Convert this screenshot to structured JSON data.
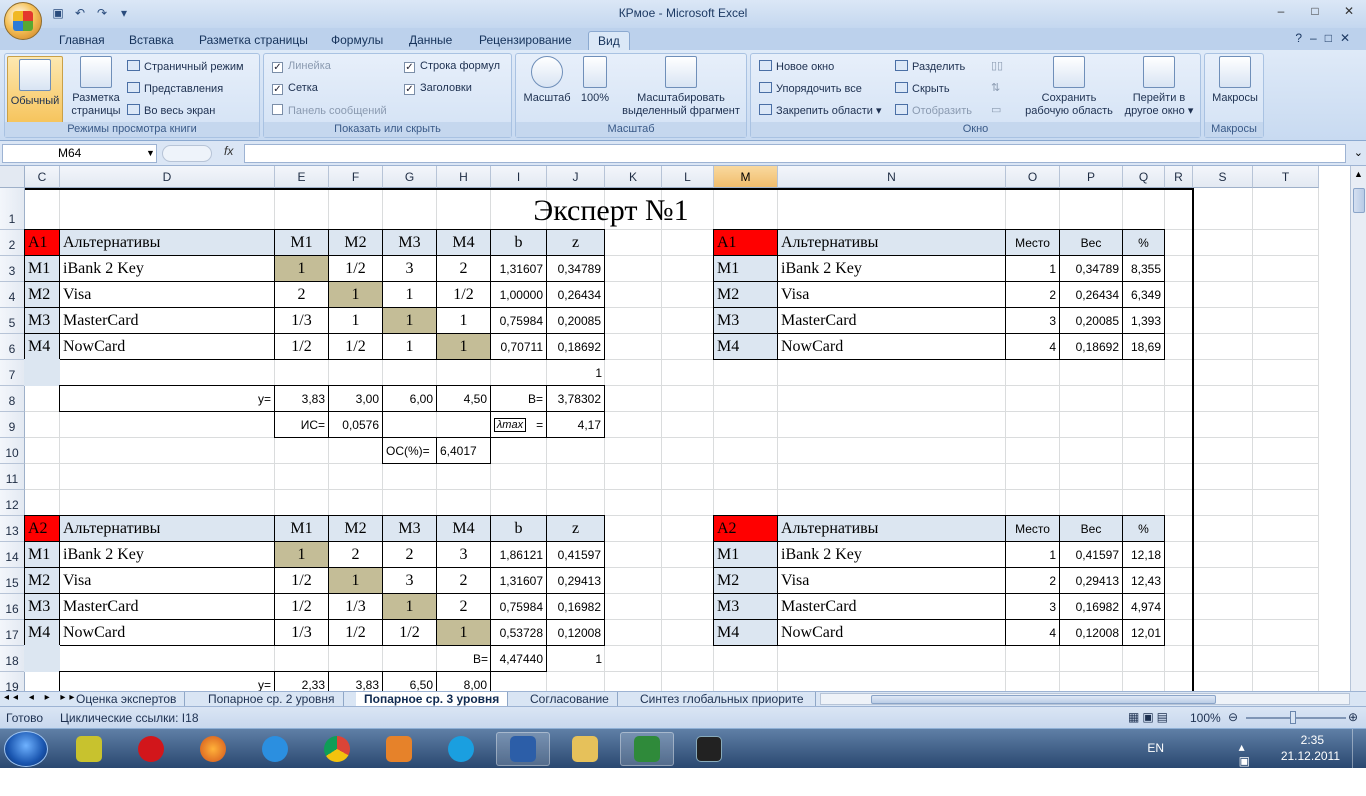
{
  "window": {
    "title": "КРмое - Microsoft Excel"
  },
  "ribbon_tabs": [
    "Главная",
    "Вставка",
    "Разметка страницы",
    "Формулы",
    "Данные",
    "Рецензирование",
    "Вид"
  ],
  "active_tab": "Вид",
  "ribbon": {
    "views_group": {
      "label": "Режимы просмотра книги",
      "normal": "Обычный",
      "page_layout_1": "Разметка",
      "page_layout_2": "страницы",
      "page_mode": "Страничный режим",
      "custom_views": "Представления",
      "full_screen": "Во весь экран"
    },
    "show_group": {
      "label": "Показать или скрыть",
      "ruler": "Линейка",
      "gridlines": "Сетка",
      "message_bar": "Панель сообщений",
      "formula_bar": "Строка формул",
      "headings": "Заголовки"
    },
    "zoom_group": {
      "label": "Масштаб",
      "zoom": "Масштаб",
      "zoom100": "100%",
      "zoom_sel_1": "Масштабировать",
      "zoom_sel_2": "выделенный фрагмент"
    },
    "window_group": {
      "label": "Окно",
      "new_window": "Новое окно",
      "arrange_all": "Упорядочить все",
      "freeze": "Закрепить области",
      "split": "Разделить",
      "hide": "Скрыть",
      "unhide": "Отобразить",
      "save_ws_1": "Сохранить",
      "save_ws_2": "рабочую область",
      "switch_1": "Перейти в",
      "switch_2": "другое окно"
    },
    "macros_group": {
      "label": "Макросы",
      "macros": "Макросы"
    }
  },
  "formula_bar": {
    "name_box": "M64",
    "fx": "fx",
    "formula": ""
  },
  "columns": [
    "C",
    "D",
    "E",
    "F",
    "G",
    "H",
    "I",
    "J",
    "K",
    "L",
    "M",
    "N",
    "O",
    "P",
    "Q",
    "R",
    "S",
    "T"
  ],
  "rows": [
    "1",
    "2",
    "3",
    "4",
    "5",
    "6",
    "7",
    "8",
    "9",
    "10",
    "11",
    "12",
    "13",
    "14",
    "15",
    "16",
    "17",
    "18",
    "19"
  ],
  "sheet_title": "Эксперт №1",
  "block1": {
    "tag": "A1",
    "headers": [
      "Альтернативы",
      "M1",
      "M2",
      "M3",
      "M4",
      "b",
      "z"
    ],
    "rows": [
      {
        "id": "M1",
        "name": "iBank 2 Key",
        "m": [
          "1",
          "1/2",
          "3",
          "2"
        ],
        "b": "1,31607",
        "z": "0,34789"
      },
      {
        "id": "M2",
        "name": "Visa",
        "m": [
          "2",
          "1",
          "1",
          "1/2"
        ],
        "b": "1,00000",
        "z": "0,26434"
      },
      {
        "id": "M3",
        "name": "MasterCard",
        "m": [
          "1/3",
          "1",
          "1",
          "1"
        ],
        "b": "0,75984",
        "z": "0,20085"
      },
      {
        "id": "M4",
        "name": "NowCard",
        "m": [
          "1/2",
          "1/2",
          "1",
          "1"
        ],
        "b": "0,70711",
        "z": "0,18692"
      }
    ],
    "zsum": "1",
    "y_label": "y=",
    "y": [
      "3,83",
      "3,00",
      "6,00",
      "4,50"
    ],
    "B_label": "B=",
    "B": "3,78302",
    "ic_label": "ИС=",
    "ic": "0,0576",
    "lmax_label": "λmax",
    "lmax_eq": "=",
    "lmax": "4,17",
    "oc_label": "ОС(%)=",
    "oc": "6,4017"
  },
  "block2": {
    "tag": "A2",
    "headers": [
      "Альтернативы",
      "M1",
      "M2",
      "M3",
      "M4",
      "b",
      "z"
    ],
    "rows": [
      {
        "id": "M1",
        "name": "iBank 2 Key",
        "m": [
          "1",
          "2",
          "2",
          "3"
        ],
        "b": "1,86121",
        "z": "0,41597"
      },
      {
        "id": "M2",
        "name": "Visa",
        "m": [
          "1/2",
          "1",
          "3",
          "2"
        ],
        "b": "1,31607",
        "z": "0,29413"
      },
      {
        "id": "M3",
        "name": "MasterCard",
        "m": [
          "1/2",
          "1/3",
          "1",
          "2"
        ],
        "b": "0,75984",
        "z": "0,16982"
      },
      {
        "id": "M4",
        "name": "NowCard",
        "m": [
          "1/3",
          "1/2",
          "1/2",
          "1"
        ],
        "b": "0,53728",
        "z": "0,12008"
      }
    ],
    "B_label": "B=",
    "B": "4,47440",
    "zsum": "1",
    "y_label": "y=",
    "y": [
      "2,33",
      "3,83",
      "6,50",
      "8,00"
    ]
  },
  "rank1": {
    "tag": "A1",
    "headers": [
      "Альтернативы",
      "Место",
      "Вес",
      "%"
    ],
    "rows": [
      {
        "id": "M1",
        "name": "iBank 2 Key",
        "place": "1",
        "weight": "0,34789",
        "pct": "8,355"
      },
      {
        "id": "M2",
        "name": "Visa",
        "place": "2",
        "weight": "0,26434",
        "pct": "6,349"
      },
      {
        "id": "M3",
        "name": "MasterCard",
        "place": "3",
        "weight": "0,20085",
        "pct": "1,393"
      },
      {
        "id": "M4",
        "name": "NowCard",
        "place": "4",
        "weight": "0,18692",
        "pct": "18,69"
      }
    ]
  },
  "rank2": {
    "tag": "A2",
    "headers": [
      "Альтернативы",
      "Место",
      "Вес",
      "%"
    ],
    "rows": [
      {
        "id": "M1",
        "name": "iBank 2 Key",
        "place": "1",
        "weight": "0,41597",
        "pct": "12,18"
      },
      {
        "id": "M2",
        "name": "Visa",
        "place": "2",
        "weight": "0,29413",
        "pct": "12,43"
      },
      {
        "id": "M3",
        "name": "MasterCard",
        "place": "3",
        "weight": "0,16982",
        "pct": "4,974"
      },
      {
        "id": "M4",
        "name": "NowCard",
        "place": "4",
        "weight": "0,12008",
        "pct": "12,01"
      }
    ]
  },
  "sheet_tabs": [
    "Оценка экспертов",
    "Попарное ср. 2 уровня",
    "Попарное ср. 3 уровня",
    "Согласование",
    "Синтез глобальных приорите"
  ],
  "active_sheet": "Попарное ср. 3 уровня",
  "status": {
    "ready": "Готово",
    "circular": "Циклические ссылки: I18",
    "zoom": "100%"
  },
  "taskbar": {
    "lang": "EN",
    "time": "2:35",
    "date": "21.12.2011"
  },
  "colors": {
    "red_tag": "#ff0000",
    "diag": "#c4bd97",
    "header_fill": "#dce6f1"
  }
}
